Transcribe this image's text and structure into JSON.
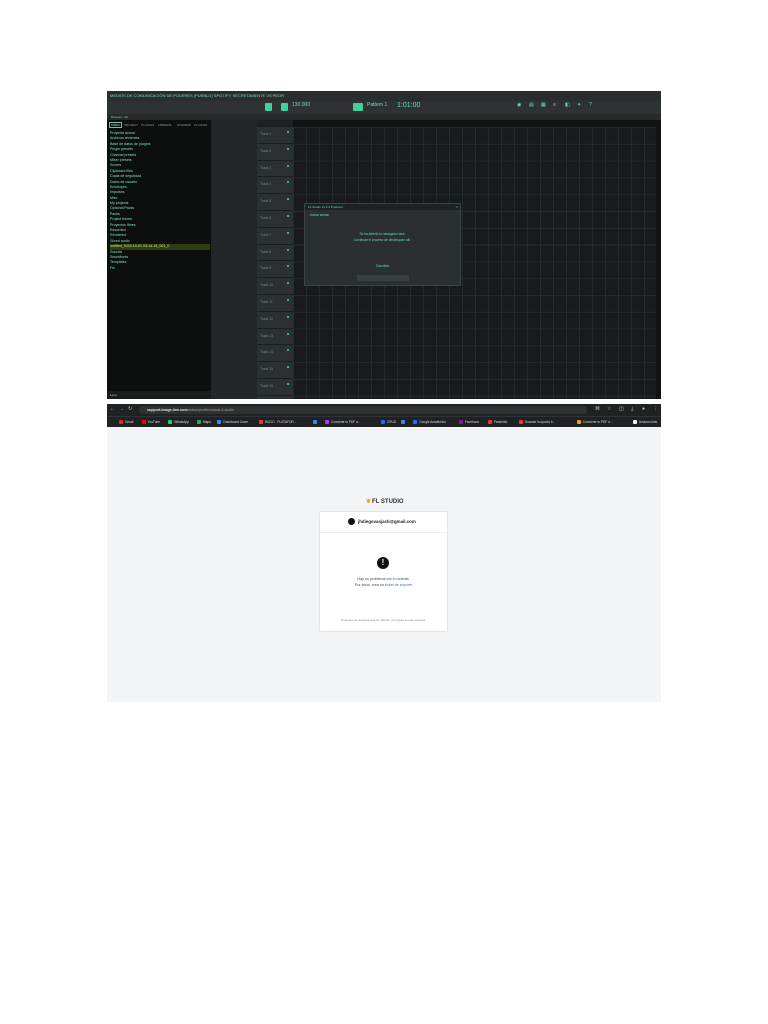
{
  "fl_studio": {
    "title": "MEDIOS DE COMUNICACIÓN DE PODERES (PUEBLO) SPOTIFY, SECRETAMENTE VS PEOR",
    "toolbar": {
      "tempo": "130.000",
      "pattern": "Pattern 1",
      "time": "1:01:00"
    },
    "hint": "Browser - All",
    "browser": {
      "tabs": [
        "TODO",
        "PROJECT",
        "PLUGINS",
        "LIBRERÍA",
        "STARRED",
        "PLUGINS"
      ],
      "items": [
        "Proyecto actual",
        "Archivos recientes",
        "Base de datos de plugins",
        "Plugin presets",
        "Channel presets",
        "Mixer presets",
        "Scores",
        "Clipboard files",
        "Copia de seguridad",
        "Datos de usuario",
        "Envelopes",
        "Impulses",
        "Misc",
        "My projects",
        "Optional Packs",
        "Packs",
        "Project bones",
        "Proyectos libres",
        "Recorded",
        "Rendered",
        "Sliced audio",
        "untitled_2024-10-01 03-14-15_001_0",
        "Sounds",
        "Soundfonts",
        "Templates",
        "Ftc"
      ],
      "selected_index": 21,
      "footer": "Leon"
    },
    "tracks": [
      "Track 1",
      "Track 2",
      "Track 3",
      "Track 4",
      "Track 5",
      "Track 6",
      "Track 7",
      "Track 8",
      "Track 9",
      "Track 10",
      "Track 11",
      "Track 12",
      "Track 13",
      "Track 14",
      "Track 15",
      "Track 16"
    ],
    "playlist_title": "Playlist - Arrangement - Arrangement",
    "dialog": {
      "title": "FL Studio 21.2.3 Producer",
      "subheading": "Iniciar sesión",
      "line1": "Se ha abierto tu navegador web.",
      "line2": "Continuar el proceso de desbloqueo allí.",
      "cancel": "Cancelar"
    }
  },
  "web_browser": {
    "url_host": "support.image-line.com",
    "url_path": "/action/profile/unlock-fl-studio",
    "bookmarks": [
      "Gmail",
      "YouTube",
      "WhatsApp",
      "Maps",
      "Dashboard Zoom",
      "INICIO - PLATAFOR...",
      "",
      "Convierte tu PDF a...",
      "CRUD",
      "",
      "Google Académico",
      "Facebook",
      "Paraninfo",
      "Guardar la opción b...",
      "Convierte tu PDF a...",
      "Amazon kids",
      "YUKiler - Convertid..."
    ],
    "logo": "FL STUDIO",
    "email": "jhdiegovasjacb@gmail.com",
    "warning_icon": "!",
    "warning_line1": "Hay un problema con tu cuenta.",
    "warning_line2_prefix": "Por favor, ",
    "warning_line2_mid": "crea un ",
    "warning_link": "ticket de soporte",
    "footer": "Después de desbloquear FL Studio, ya regres a esta ventana."
  }
}
